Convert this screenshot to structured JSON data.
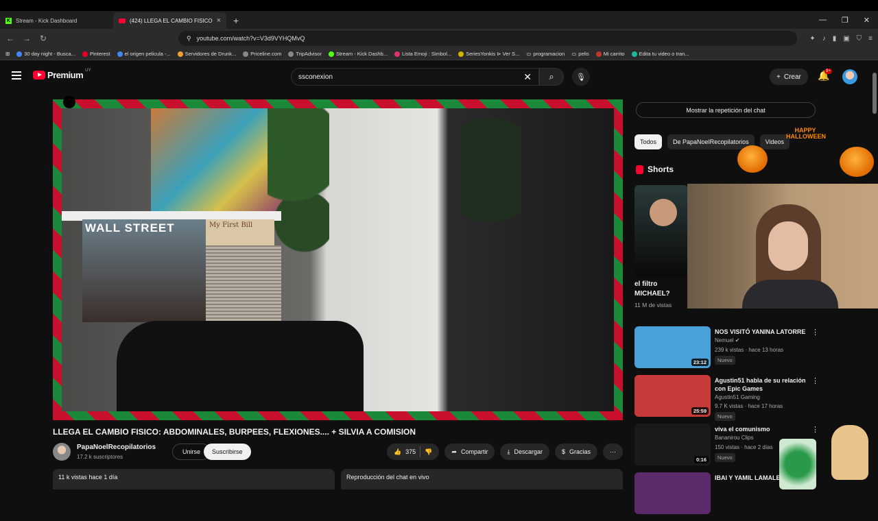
{
  "browser": {
    "tabs": [
      {
        "title": "Stream - Kick Dashboard",
        "favicon": "kick-icon"
      },
      {
        "title": "(424) LLEGA EL CAMBIO FISICO...",
        "favicon": "youtube-icon",
        "active": true
      }
    ],
    "url": "youtube.com/watch?v=V3d9VYHQMvQ",
    "bookmarks": [
      {
        "label": "30 day night - Busca...",
        "color": "#4285f4"
      },
      {
        "label": "Pinterest",
        "color": "#e60023"
      },
      {
        "label": "el origen pelicula -...",
        "color": "#4285f4"
      },
      {
        "label": "Servidores de Drunk...",
        "color": "#f0a030"
      },
      {
        "label": "Priceline.com",
        "color": "#888888"
      },
      {
        "label": "TripAdvisor",
        "color": "#888888"
      },
      {
        "label": "Stream - Kick Dashb...",
        "color": "#53fc18"
      },
      {
        "label": "Lista Emoji : Simbol...",
        "color": "#e03070"
      },
      {
        "label": "SeriesYonkis ⊳ Ver S...",
        "color": "#d0b000"
      },
      {
        "label": "programacion",
        "color": "folder"
      },
      {
        "label": "pelis",
        "color": "folder"
      },
      {
        "label": "Mi carrito",
        "color": "#c0392b"
      },
      {
        "label": "Edita tu video o tran...",
        "color": "#1bbc9b"
      }
    ]
  },
  "header": {
    "logo_text": "Premium",
    "country": "UY",
    "search_value": "ssconexion",
    "create_label": "Crear",
    "notification_count": "9+"
  },
  "video": {
    "title": "LLEGA EL CAMBIO FISICO: ABDOMINALES, BURPEES, FLEXIONES.... + SILVIA A COMISION",
    "poster_text": "WALL STREET",
    "poster2_text": "My First Bill",
    "channel_name": "PapaNoelRecopilatorios",
    "subscribers": "17.2 k suscriptores",
    "join_label": "Unirse",
    "subscribe_label": "Suscribirse",
    "likes": "375",
    "share_label": "Compartir",
    "download_label": "Descargar",
    "thanks_label": "Gracias",
    "views_date": "11 k vistas  hace 1 día",
    "chat_label": "Reproducción del chat en vivo"
  },
  "sidebar": {
    "chat_replay_label": "Mostrar la repetición del chat",
    "chips": [
      "Todos",
      "De PapaNoelRecopilatorios",
      "Videos"
    ],
    "shorts_label": "Shorts",
    "short": {
      "title": "el filtro MICHAEL?",
      "views": "11 M de vistas"
    },
    "recommendations": [
      {
        "title": "NOS VISITÓ YANINA LATORRE",
        "channel": "Nemuel ✔",
        "meta": "239 k vistas · hace 13 horas",
        "badge": "Nuevo",
        "duration": "23:12",
        "thumb": "#4aa0d8"
      },
      {
        "title": "Agustin51 habla de su relación con Epic Games",
        "channel": "Agustin51 Gaming",
        "meta": "9.7 K vistas · hace 17 horas",
        "badge": "Nuevo",
        "duration": "25:59",
        "thumb": "#c83a3a"
      },
      {
        "title": "viva el comunismo",
        "channel": "Bananirou Clips",
        "meta": "150 vistas · hace 2 días",
        "badge": "Nuevo",
        "duration": "0:16",
        "thumb": "#1a1a1a"
      },
      {
        "title": "IBAI Y YAMIL LAMALE...",
        "channel": "",
        "meta": "",
        "badge": "",
        "duration": "",
        "thumb": "#5a2a6a"
      }
    ]
  },
  "overlay": {
    "happy_text": "HAPPY HALLOWEEN"
  },
  "colors": {
    "accent": "#ff0033",
    "background": "#0f0f0f",
    "frame_red": "#c8102e",
    "frame_green": "#1a8a3a"
  }
}
